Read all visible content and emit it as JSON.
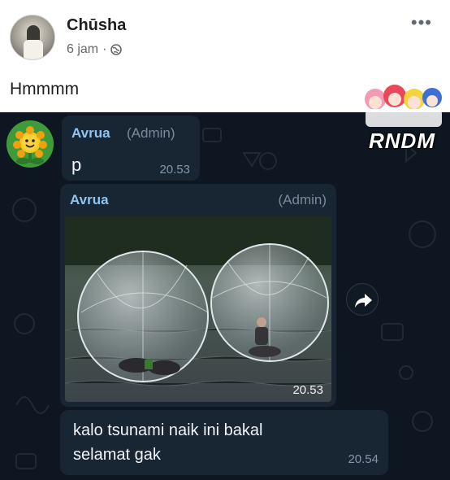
{
  "post": {
    "author": "Chūsha",
    "time": "6 jam",
    "separator": "·",
    "audience_icon": "globe-icon",
    "more_icon": "•••",
    "caption": "Hmmmm"
  },
  "chat": {
    "messages": [
      {
        "sender": "Avrua",
        "role": "(Admin)",
        "text": "p",
        "time": "20.53",
        "avatar_icon": "peashooter-icon"
      },
      {
        "sender": "Avrua",
        "role": "(Admin)",
        "media": "photo of people inside water balls",
        "time": "20.53",
        "share_icon": "share-arrow-icon"
      },
      {
        "text": "kalo tsunami naik ini bakal selamat gak",
        "time": "20.54"
      }
    ]
  },
  "watermark": {
    "text": "RNDM"
  },
  "colors": {
    "chat_background": "#0e1621",
    "bubble": "#182533",
    "sender_name": "#8fc5f0",
    "admin_tag": "#7b8a9b",
    "facebook_text": "#1c1e21",
    "facebook_meta": "#65676b"
  }
}
